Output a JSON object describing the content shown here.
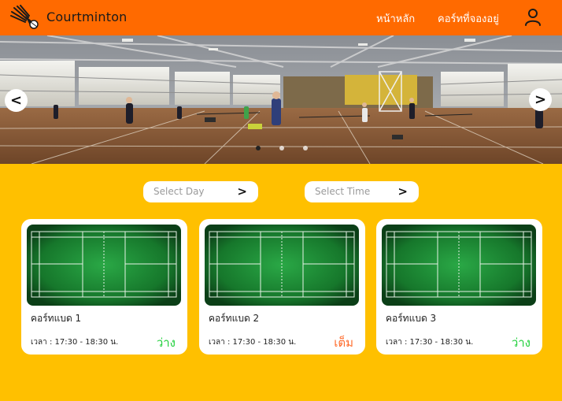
{
  "header": {
    "brand": "Courtminton",
    "nav": {
      "home": "หน้าหลัก",
      "booked": "คอร์ทที่จองอยู่"
    },
    "icons": {
      "logo": "shuttlecock-logo-icon",
      "user": "user-icon"
    }
  },
  "banner": {
    "prev_label": "<",
    "next_label": ">",
    "slide_count": 3,
    "active_slide": 1
  },
  "filters": {
    "day": {
      "placeholder": "Select Day",
      "chevron": ">"
    },
    "time": {
      "placeholder": "Select Time",
      "chevron": ">"
    }
  },
  "courts": [
    {
      "name": "คอร์ทแบด 1",
      "time": "เวลา : 17:30 - 18:30 น.",
      "status": "ว่าง",
      "status_color": "#1fcf3a"
    },
    {
      "name": "คอร์ทแบด 2",
      "time": "เวลา : 17:30 - 18:30 น.",
      "status": "เต็ม",
      "status_color": "#ff6a2a"
    },
    {
      "name": "คอร์ทแบด 3",
      "time": "เวลา : 17:30 - 18:30 น.",
      "status": "ว่าง",
      "status_color": "#1fcf3a"
    }
  ],
  "colors": {
    "header": "#FF6A00",
    "page_background": "#FFC000",
    "court_green": "#1a8a2e"
  }
}
